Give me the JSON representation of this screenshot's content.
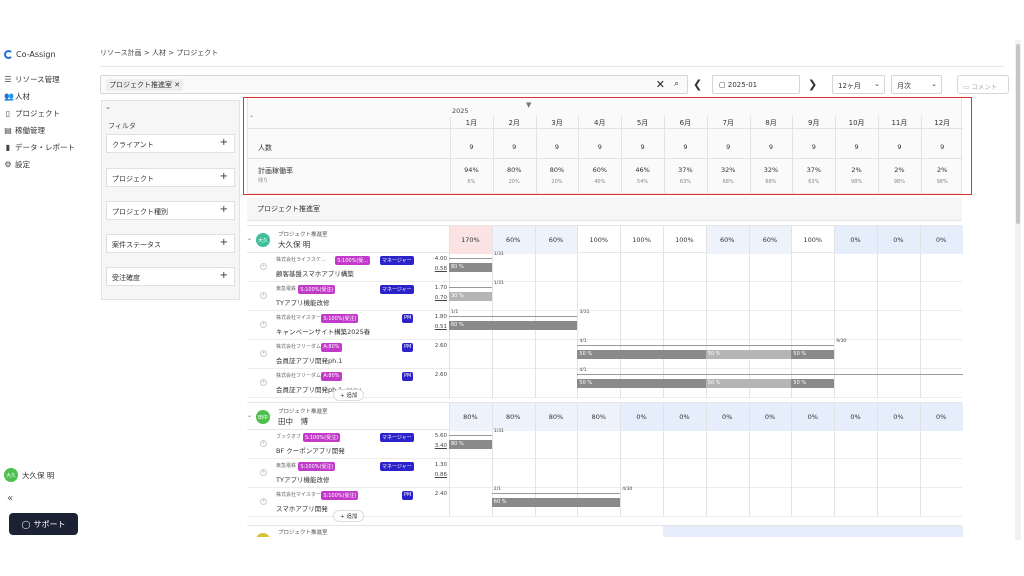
{
  "app": {
    "name": "Co-Assign"
  },
  "sidebar": {
    "items": [
      {
        "label": "リソース管理",
        "icon": "list-icon"
      },
      {
        "label": "人材",
        "icon": "people-icon"
      },
      {
        "label": "プロジェクト",
        "icon": "document-icon"
      },
      {
        "label": "稼働管理",
        "icon": "calendar-icon"
      },
      {
        "label": "データ・レポート",
        "icon": "chart-icon"
      },
      {
        "label": "設定",
        "icon": "gear-icon"
      }
    ],
    "user": {
      "initials": "大久",
      "name": "大久保 明"
    },
    "collapse": "«",
    "support": "サポート"
  },
  "header": {
    "breadcrumb": "リソース計画 > 人材 > プロジェクト",
    "search_chip": "プロジェクト推進室",
    "date": "2025-01",
    "span": "12ヶ月",
    "unit": "月次",
    "comment": "コメント"
  },
  "filter": {
    "title": "フィルタ",
    "items": [
      "クライアント",
      "プロジェクト",
      "プロジェクト種別",
      "案件ステータス",
      "受注確度"
    ]
  },
  "grid": {
    "year": "2025",
    "months": [
      "1月",
      "2月",
      "3月",
      "4月",
      "5月",
      "6月",
      "7月",
      "8月",
      "9月",
      "10月",
      "11月",
      "12月"
    ],
    "summary": {
      "headcount_label": "人数",
      "headcount": [
        "9",
        "9",
        "9",
        "9",
        "9",
        "9",
        "9",
        "9",
        "9",
        "9",
        "9",
        "9"
      ],
      "rate_label": "計画稼働率",
      "remaining_label": "残り",
      "rates": [
        "94%",
        "80%",
        "80%",
        "60%",
        "46%",
        "37%",
        "32%",
        "32%",
        "37%",
        "2%",
        "2%",
        "2%"
      ],
      "remaining": [
        "6%",
        "20%",
        "20%",
        "40%",
        "54%",
        "63%",
        "68%",
        "68%",
        "63%",
        "98%",
        "98%",
        "98%"
      ]
    },
    "dept_label": "プロジェクト推進室",
    "add_label": "+ 追加",
    "people": [
      {
        "initials": "大久",
        "dept": "プロジェクト推進室",
        "name": "大久保 明",
        "avatar_color": "#3fbf9a",
        "util": [
          "170%",
          "60%",
          "60%",
          "100%",
          "100%",
          "100%",
          "60%",
          "60%",
          "100%",
          "0%",
          "0%",
          "0%"
        ],
        "projects": [
          {
            "client": "株式会社ライフスケ...",
            "name": "顧客基盤スマホアプリ構築",
            "tag1": "S:100%(受...",
            "tag2": "マネージャー",
            "h1": "4.00",
            "h2": "0.58",
            "bar_label": "80 %",
            "date": "1/31"
          },
          {
            "client": "東急電鉄",
            "name": "TYアプリ機能改修",
            "tag1": "S:100%(受注)",
            "tag2": "マネージャー",
            "h1": "1.70",
            "h2": "0.70",
            "bar_label": "30 %",
            "date": "1/31"
          },
          {
            "client": "株式会社マイスター",
            "name": "キャンペーンサイト構築2025春",
            "tag1": "S:100%(受注)",
            "tag2": "PM",
            "h1": "1.80",
            "h2": "0.51",
            "bar_label": "60 %",
            "date": "3/31",
            "date_start": "1/1"
          },
          {
            "client": "株式会社フリーダム",
            "name": "会員証アプリ開発ph.1",
            "tag1": "A:80%",
            "tag2": "PM",
            "h1": "2.60",
            "h2": "",
            "bar_label": "50 %",
            "date": "9/30",
            "date_start": "4/1"
          },
          {
            "client": "株式会社フリーダム",
            "name": "会員証アプリ開発ph.1_copy",
            "tag1": "A:80%",
            "tag2": "PM",
            "h1": "2.60",
            "h2": "",
            "bar_label": "50 %",
            "date": "",
            "date_start": "4/1"
          }
        ]
      },
      {
        "initials": "田中",
        "dept": "プロジェクト推進室",
        "name": "田中　博",
        "avatar_color": "#4cc04c",
        "util": [
          "80%",
          "80%",
          "80%",
          "80%",
          "0%",
          "0%",
          "0%",
          "0%",
          "0%",
          "0%",
          "0%",
          "0%"
        ],
        "projects": [
          {
            "client": "ブックオフ",
            "name": "BF クーポンアプリ開発",
            "tag1": "S:100%(受注)",
            "tag2": "マネージャー",
            "h1": "5.60",
            "h2": "3.40",
            "bar_label": "80 %",
            "date": "1/31"
          },
          {
            "client": "東急電鉄",
            "name": "TYアプリ機能改修",
            "tag1": "S:100%(受注)",
            "tag2": "マネージャー",
            "h1": "1.30",
            "h2": "0.86",
            "bar_label": "",
            "date": ""
          },
          {
            "client": "株式会社マイスター",
            "name": "スマホアプリ開発",
            "tag1": "S:100%(受注)",
            "tag2": "PM",
            "h1": "2.40",
            "h2": "",
            "bar_label": "60 %",
            "date": "4/30",
            "date_start": "2/1"
          }
        ]
      }
    ],
    "next_dept": "プロジェクト推進室"
  }
}
